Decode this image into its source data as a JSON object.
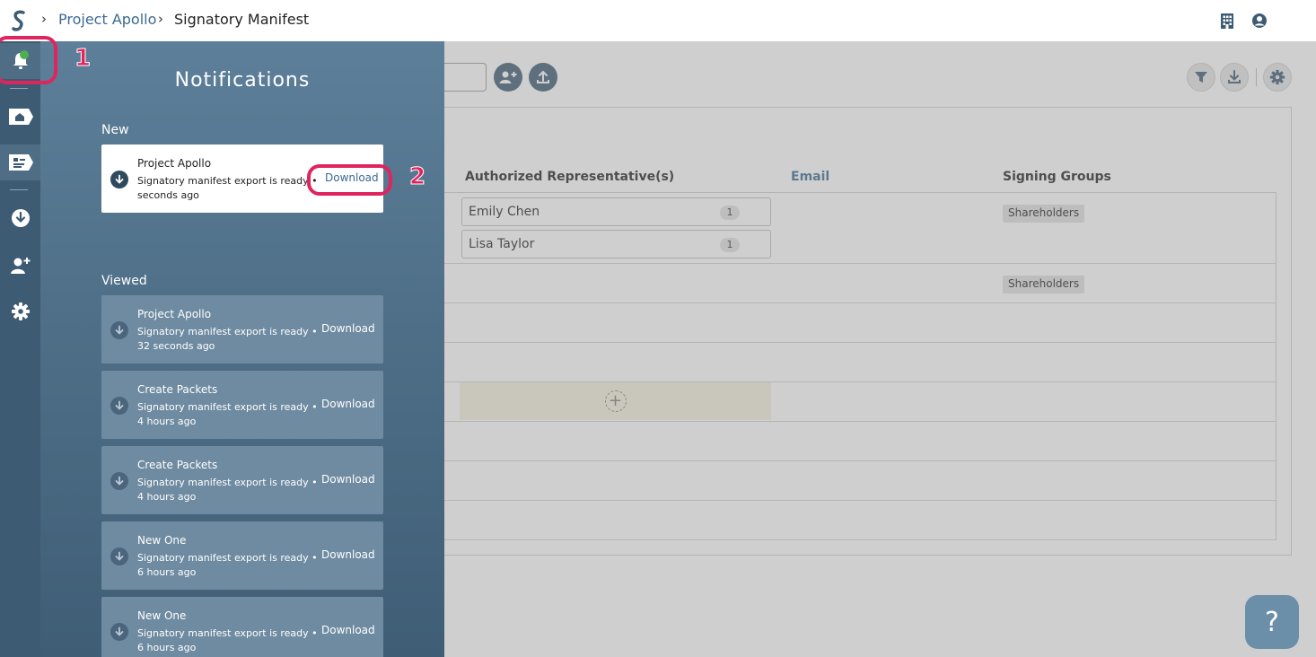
{
  "breadcrumb": {
    "project": "Project Apollo",
    "page": "Signatory Manifest"
  },
  "icons": {
    "logo": "brand-s-logo",
    "building": "building-icon",
    "account": "account-icon"
  },
  "rail": {
    "items": [
      {
        "name": "notifications-icon",
        "active": true
      },
      {
        "name": "home-icon",
        "active": false
      },
      {
        "name": "manifest-icon",
        "active": true
      },
      {
        "name": "download-icon",
        "active": false
      },
      {
        "name": "add-user-icon",
        "active": false
      },
      {
        "name": "gear-icon",
        "active": false
      }
    ]
  },
  "notifications": {
    "title": "Notifications",
    "new_label": "New",
    "viewed_label": "Viewed",
    "new": [
      {
        "title": "Project Apollo",
        "message": "Signatory manifest export is ready • seconds ago",
        "action": "Download"
      }
    ],
    "viewed": [
      {
        "title": "Project Apollo",
        "message": "Signatory manifest export is ready • 32 seconds ago",
        "action": "Download"
      },
      {
        "title": "Create Packets",
        "message": "Signatory manifest export is ready • 4 hours ago",
        "action": "Download"
      },
      {
        "title": "Create Packets",
        "message": "Signatory manifest export is ready • 4 hours ago",
        "action": "Download"
      },
      {
        "title": "New One",
        "message": "Signatory manifest export is ready • 6 hours ago",
        "action": "Download"
      },
      {
        "title": "New One",
        "message": "Signatory manifest export is ready • 6 hours ago",
        "action": "Download"
      }
    ]
  },
  "table": {
    "headers": [
      "Authorized Representative(s)",
      "Email",
      "Signing Groups"
    ],
    "rows": [
      {
        "reps": [
          {
            "name": "Emily Chen",
            "count": "1"
          },
          {
            "name": "Lisa Taylor",
            "count": "1"
          }
        ],
        "group": "Shareholders"
      },
      {
        "reps": [],
        "group": "Shareholders"
      }
    ],
    "add_symbol": "+"
  },
  "help": {
    "label": "?"
  },
  "annotations": {
    "one": "1",
    "two": "2"
  },
  "colors": {
    "accent": "#3d5b72",
    "link": "#3b6a93",
    "highlight": "#e0245e",
    "unread_dot": "#4caf50"
  }
}
